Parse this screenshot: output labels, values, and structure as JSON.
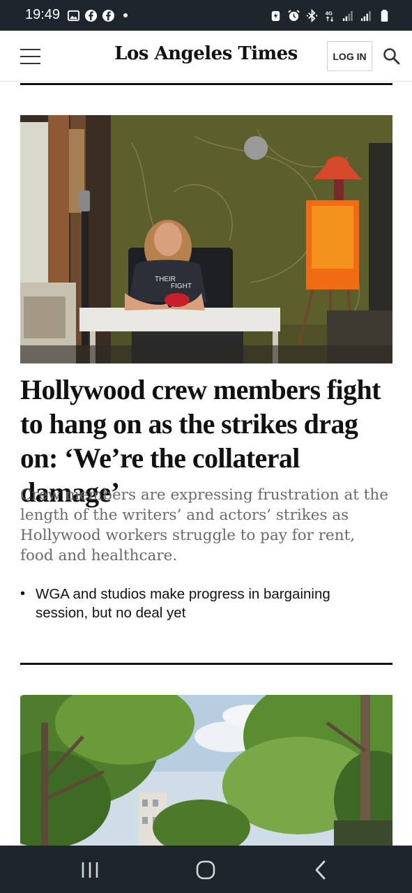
{
  "status_bar": {
    "time": "19:49",
    "left_icons": [
      "gallery-icon",
      "facebook-icon",
      "facebook-icon",
      "notification-dot-icon"
    ],
    "right_icons": [
      "battery-saver-icon",
      "alarm-icon",
      "bluetooth-icon",
      "4g-icon",
      "signal-icon",
      "signal-icon",
      "battery-icon"
    ],
    "network_label": "4G"
  },
  "header": {
    "menu_icon": "hamburger-menu-icon",
    "masthead": "Los Angeles Times",
    "login_label": "LOG IN",
    "search_icon": "search-icon"
  },
  "article": {
    "headline": "Hollywood crew members fight to hang on as the strikes drag on: ‘We’re the collateral damage’",
    "dek": "Crew members are expressing frustration at the length of the writers’ and actors’ strikes as Hollywood workers struggle to pay for rent, food and healthcare.",
    "related": [
      {
        "text": "WGA and studios make progress in bargaining session, but no deal yet"
      }
    ],
    "image_shirt_text": [
      "THEIR",
      "FIGHT"
    ]
  },
  "nav_bar": {
    "buttons": [
      "recent-apps-icon",
      "home-icon",
      "back-icon"
    ]
  },
  "colors": {
    "system_bar": "#1e252d",
    "headline": "#111111",
    "dek": "#6a6a6a",
    "rule": "#111111"
  }
}
